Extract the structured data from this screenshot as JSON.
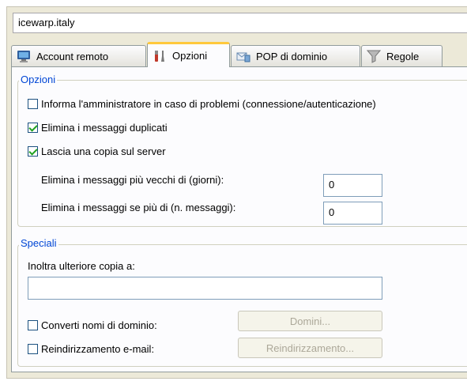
{
  "header": {
    "account": "icewarp.italy"
  },
  "tabs": [
    {
      "label": "Account remoto",
      "icon": "monitor-icon",
      "active": false
    },
    {
      "label": "Opzioni",
      "icon": "tools-icon",
      "active": true
    },
    {
      "label": "POP di dominio",
      "icon": "mail-server-icon",
      "active": false
    },
    {
      "label": "Regole",
      "icon": "filter-icon",
      "active": false
    }
  ],
  "opzioni": {
    "legend": "Opzioni",
    "notify_admin": {
      "label": "Informa l'amministratore in caso di problemi (connessione/autenticazione)",
      "checked": false
    },
    "delete_duplicates": {
      "label": "Elimina i messaggi duplicati",
      "checked": true
    },
    "keep_copy": {
      "label": "Lascia una copia sul server",
      "checked": true
    },
    "older_than_days": {
      "label": "Elimina i messaggi più vecchi di (giorni):",
      "value": "0"
    },
    "more_than_count": {
      "label": "Elimina i messaggi se più di (n. messaggi):",
      "value": "0"
    }
  },
  "speciali": {
    "legend": "Speciali",
    "forward_label": "Inoltra ulteriore copia a:",
    "forward_value": "",
    "convert_domains": {
      "label": "Converti nomi di dominio:",
      "checked": false,
      "button": "Domini..."
    },
    "redirect_email": {
      "label": "Reindirizzamento e-mail:",
      "checked": false,
      "button": "Reindirizzamento..."
    }
  },
  "colors": {
    "legend": "#0046d5",
    "active_tab_accent": "#ffc83c",
    "check": "#21a121"
  }
}
